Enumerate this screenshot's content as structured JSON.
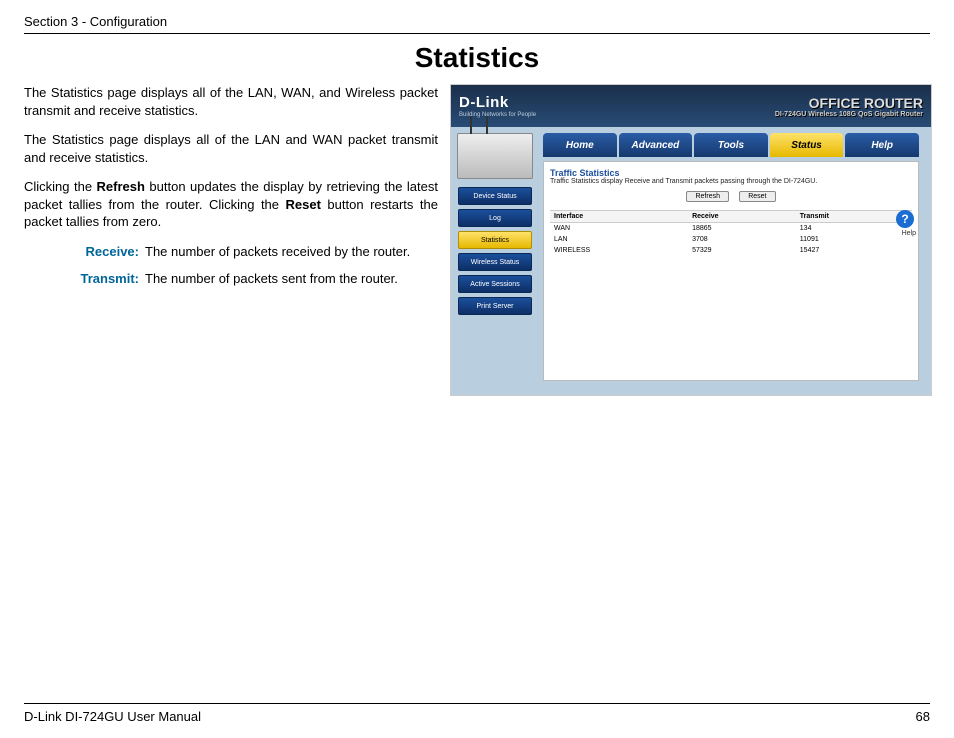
{
  "header": {
    "section": "Section 3 - Configuration"
  },
  "title": "Statistics",
  "paragraphs": {
    "p1": "The Statistics page displays all of the LAN, WAN, and Wireless packet transmit and receive statistics.",
    "p2": "The Statistics page displays all of the LAN and WAN packet transmit and receive statistics.",
    "p3a": "Clicking the ",
    "p3b": "Refresh",
    "p3c": " button updates the display by retrieving the latest packet tallies from the router. Clicking the ",
    "p3d": "Reset",
    "p3e": " button restarts the packet tallies from zero."
  },
  "defs": {
    "receive_label": "Receive:",
    "receive_text": "The number of packets received by the router.",
    "transmit_label": "Transmit:",
    "transmit_text": "The number of packets sent from the router."
  },
  "shot": {
    "logo": "D-Link",
    "logo_sub": "Building Networks for People",
    "product": "OFFICE ROUTER",
    "product_sub": "DI-724GU  Wireless 108G QoS Gigabit Router",
    "tabs": [
      "Home",
      "Advanced",
      "Tools",
      "Status",
      "Help"
    ],
    "active_tab": "Status",
    "side": [
      "Device Status",
      "Log",
      "Statistics",
      "Wireless Status",
      "Active Sessions",
      "Print Server"
    ],
    "active_side": "Statistics",
    "panel_title": "Traffic Statistics",
    "panel_desc": "Traffic Statistics display Receive and Transmit packets passing through the DI-724GU.",
    "btn_refresh": "Refresh",
    "btn_reset": "Reset",
    "help": "?",
    "help_label": "Help",
    "chart_data": {
      "type": "table",
      "columns": [
        "Interface",
        "Receive",
        "Transmit"
      ],
      "rows": [
        {
          "Interface": "WAN",
          "Receive": "18865",
          "Transmit": "134"
        },
        {
          "Interface": "LAN",
          "Receive": "3708",
          "Transmit": "11091"
        },
        {
          "Interface": "WIRELESS",
          "Receive": "57329",
          "Transmit": "15427"
        }
      ]
    }
  },
  "footer": {
    "left": "D-Link DI-724GU User Manual",
    "page": "68"
  }
}
